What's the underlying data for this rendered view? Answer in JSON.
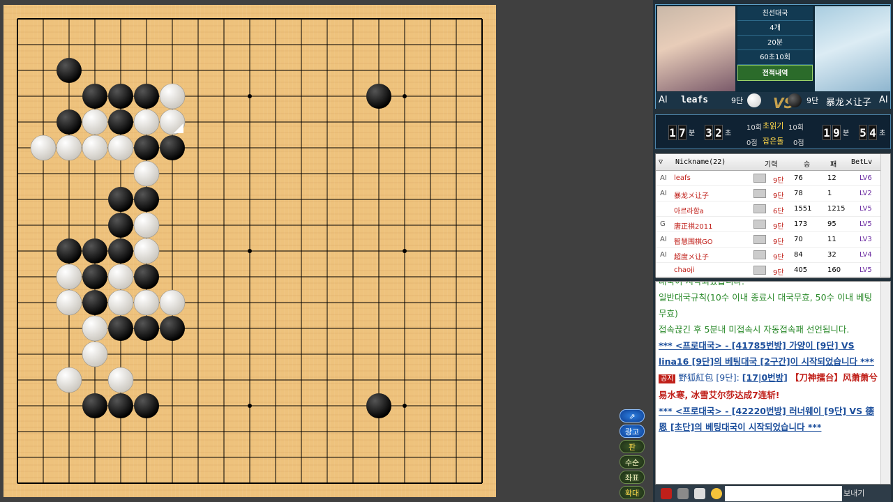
{
  "board": {
    "size": 19,
    "last_move": [
      6,
      4
    ],
    "black": [
      [
        2,
        2
      ],
      [
        3,
        3
      ],
      [
        4,
        3
      ],
      [
        5,
        3
      ],
      [
        14,
        3
      ],
      [
        2,
        4
      ],
      [
        4,
        4
      ],
      [
        5,
        5
      ],
      [
        6,
        5
      ],
      [
        4,
        7
      ],
      [
        5,
        7
      ],
      [
        4,
        8
      ],
      [
        2,
        9
      ],
      [
        3,
        9
      ],
      [
        4,
        9
      ],
      [
        3,
        10
      ],
      [
        5,
        10
      ],
      [
        3,
        11
      ],
      [
        4,
        12
      ],
      [
        5,
        12
      ],
      [
        6,
        12
      ],
      [
        3,
        15
      ],
      [
        4,
        15
      ],
      [
        5,
        15
      ],
      [
        14,
        15
      ]
    ],
    "white": [
      [
        6,
        3
      ],
      [
        3,
        4
      ],
      [
        5,
        4
      ],
      [
        6,
        4
      ],
      [
        1,
        5
      ],
      [
        2,
        5
      ],
      [
        3,
        5
      ],
      [
        4,
        5
      ],
      [
        5,
        6
      ],
      [
        5,
        8
      ],
      [
        5,
        9
      ],
      [
        2,
        10
      ],
      [
        4,
        10
      ],
      [
        2,
        11
      ],
      [
        4,
        11
      ],
      [
        5,
        11
      ],
      [
        6,
        11
      ],
      [
        3,
        12
      ],
      [
        3,
        13
      ],
      [
        2,
        14
      ],
      [
        4,
        14
      ]
    ]
  },
  "side_buttons": [
    {
      "label": ""
    },
    {
      "label": "광고"
    },
    {
      "label": "판"
    },
    {
      "label": "수순"
    },
    {
      "label": "좌표"
    },
    {
      "label": "확대"
    }
  ],
  "game_info": {
    "type": "친선대국",
    "handicap": "4개",
    "time": "20분",
    "byoyomi": "60초10회",
    "record_button": "전적내역"
  },
  "players": {
    "white": {
      "tag": "AI",
      "name": "leafs",
      "rank": "9단"
    },
    "black": {
      "tag": "AI",
      "name": "暴龙メ让子",
      "rank": "9단"
    },
    "vs": "VS"
  },
  "timer": {
    "white": {
      "min": [
        "1",
        "7"
      ],
      "sec": [
        "3",
        "2"
      ]
    },
    "black": {
      "min": [
        "1",
        "9"
      ],
      "sec": [
        "5",
        "4"
      ]
    },
    "min_unit": "분",
    "sec_unit": "초",
    "byo_left": "10회",
    "byo_label": "초읽기",
    "byo_right": "10회",
    "cap_left": "0점",
    "cap_label": "잡은돌",
    "cap_right": "0점"
  },
  "userlist": {
    "headers": [
      "Nickname(22)",
      "기력",
      "승",
      "패",
      "BetLv"
    ],
    "rows": [
      {
        "tag": "AI",
        "name": "leafs",
        "rank": "9단",
        "win": "76",
        "loss": "12",
        "lv": "LV6"
      },
      {
        "tag": "AI",
        "name": "暴龙メ让子",
        "rank": "9단",
        "win": "78",
        "loss": "1",
        "lv": "LV2"
      },
      {
        "tag": "",
        "name": "아르라함a",
        "rank": "6단",
        "win": "1551",
        "loss": "1215",
        "lv": "LV5"
      },
      {
        "tag": "G",
        "name": "唐正祺2011",
        "rank": "9단",
        "win": "173",
        "loss": "95",
        "lv": "LV5"
      },
      {
        "tag": "AI",
        "name": "智慧围棋GO",
        "rank": "9단",
        "win": "70",
        "loss": "11",
        "lv": "LV3"
      },
      {
        "tag": "AI",
        "name": "超度メ让子",
        "rank": "9단",
        "win": "84",
        "loss": "32",
        "lv": "LV4"
      },
      {
        "tag": "",
        "name": "chaoji",
        "rank": "9단",
        "win": "405",
        "loss": "160",
        "lv": "LV5"
      }
    ]
  },
  "chat": {
    "l1": "대국이 시작되었습니다.",
    "l2": "일반대국규칙(10수 이내 종료시 대국무효, 50수 이내 베팅무효)",
    "l3": "접속끊긴 후 5분내 미접속시 자동접속패 선언됩니다.",
    "l4": "*** <프로대국> - [41785번방] 가양이 [9단] VS lina16 [9단]의 베팅대국 [2구간]이 시작되었습니다 ***",
    "l5a": "공지",
    "l5b": "野狐紅包 [9단]:",
    "l5c": "[17|0번방]",
    "l5d": "【刀神擂台】风萧萧兮易水寒, 冰雪艾尔莎达成7连斩!",
    "l6": "*** <프로대국> - [42220번방] 러너웨이 [9단] VS 德恩 [초단]의 베팅대국이 시작되었습니다 ***",
    "send": "보내기"
  }
}
